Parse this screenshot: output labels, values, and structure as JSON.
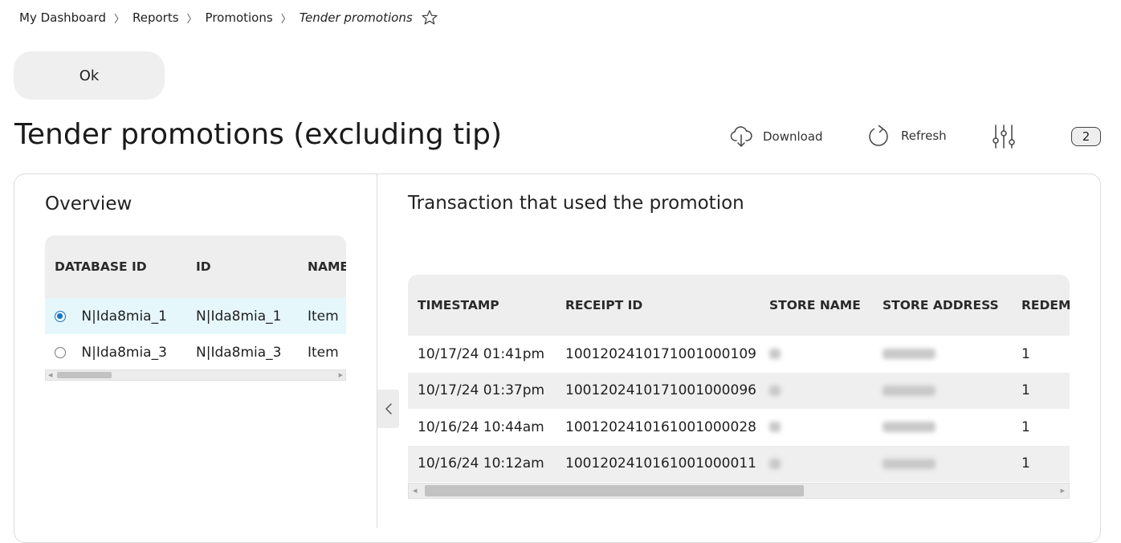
{
  "breadcrumb": {
    "items": [
      "My Dashboard",
      "Reports",
      "Promotions"
    ],
    "current": "Tender promotions",
    "separator": "〉"
  },
  "actions": {
    "ok_label": "Ok"
  },
  "page": {
    "title": "Tender promotions (excluding tip)"
  },
  "toolbar": {
    "download_label": "Download",
    "refresh_label": "Refresh",
    "count_badge": "2"
  },
  "overview": {
    "title": "Overview",
    "columns": [
      "DATABASE ID",
      "ID",
      "NAME"
    ],
    "rows": [
      {
        "selected": true,
        "database_id": "N|Ida8mia_1",
        "id": "N|Ida8mia_1",
        "name": "Item"
      },
      {
        "selected": false,
        "database_id": "N|Ida8mia_3",
        "id": "N|Ida8mia_3",
        "name": "Item"
      }
    ]
  },
  "transactions": {
    "title": "Transaction that used the promotion",
    "columns": [
      "TIMESTAMP",
      "RECEIPT ID",
      "STORE NAME",
      "STORE ADDRESS",
      "REDEMPTIONS"
    ],
    "rows": [
      {
        "timestamp": "10/17/24 01:41pm",
        "receipt_id": "1001202410171001000109",
        "redemptions": "1"
      },
      {
        "timestamp": "10/17/24 01:37pm",
        "receipt_id": "1001202410171001000096",
        "redemptions": "1"
      },
      {
        "timestamp": "10/16/24 10:44am",
        "receipt_id": "1001202410161001000028",
        "redemptions": "1"
      },
      {
        "timestamp": "10/16/24 10:12am",
        "receipt_id": "1001202410161001000011",
        "redemptions": "1"
      }
    ]
  },
  "colors": {
    "accent": "#1a73c7",
    "selected_row": "#e6f7fb",
    "header_bg": "#eeeeee"
  }
}
